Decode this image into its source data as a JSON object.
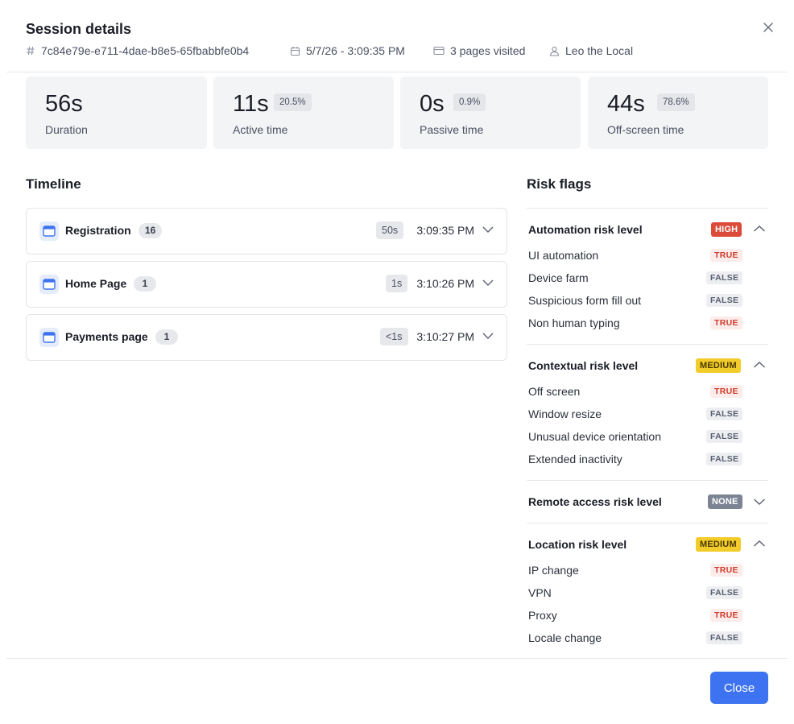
{
  "dialog": {
    "title": "Session details",
    "close_label": "Close"
  },
  "meta": {
    "session_id": "7c84e79e-e711-4dae-b8e5-65fbabbfe0b4",
    "datetime": "5/7/26 - 3:09:35 PM",
    "pages_visited": "3 pages visited",
    "user": "Leo the Local"
  },
  "stats": [
    {
      "value": "56s",
      "label": "Duration",
      "percent": ""
    },
    {
      "value": "11s",
      "label": "Active time",
      "percent": "20.5%"
    },
    {
      "value": "0s",
      "label": "Passive time",
      "percent": "0.9%"
    },
    {
      "value": "44s",
      "label": "Off-screen time",
      "percent": "78.6%"
    }
  ],
  "timeline": {
    "title": "Timeline",
    "items": [
      {
        "name": "Registration",
        "count": "16",
        "duration": "50s",
        "time": "3:09:35 PM"
      },
      {
        "name": "Home Page",
        "count": "1",
        "duration": "1s",
        "time": "3:10:26 PM"
      },
      {
        "name": "Payments page",
        "count": "1",
        "duration": "<1s",
        "time": "3:10:27 PM"
      }
    ]
  },
  "risk": {
    "title": "Risk flags",
    "groups": [
      {
        "name": "Automation risk level",
        "level": "HIGH",
        "expanded": true,
        "flags": [
          {
            "label": "UI automation",
            "value": "TRUE"
          },
          {
            "label": "Device farm",
            "value": "FALSE"
          },
          {
            "label": "Suspicious form fill out",
            "value": "FALSE"
          },
          {
            "label": "Non human typing",
            "value": "TRUE"
          }
        ]
      },
      {
        "name": "Contextual risk level",
        "level": "MEDIUM",
        "expanded": true,
        "flags": [
          {
            "label": "Off screen",
            "value": "TRUE"
          },
          {
            "label": "Window resize",
            "value": "FALSE"
          },
          {
            "label": "Unusual device orientation",
            "value": "FALSE"
          },
          {
            "label": "Extended inactivity",
            "value": "FALSE"
          }
        ]
      },
      {
        "name": "Remote access risk level",
        "level": "NONE",
        "expanded": false,
        "flags": []
      },
      {
        "name": "Location risk level",
        "level": "MEDIUM",
        "expanded": true,
        "flags": [
          {
            "label": "IP change",
            "value": "TRUE"
          },
          {
            "label": "VPN",
            "value": "FALSE"
          },
          {
            "label": "Proxy",
            "value": "TRUE"
          },
          {
            "label": "Locale change",
            "value": "FALSE"
          }
        ]
      }
    ]
  },
  "colors": {
    "accent": "#3d73f0",
    "high": "#dc4a3a",
    "medium": "#f2cc2a",
    "none": "#7c8494",
    "true_text": "#d23b2d"
  }
}
